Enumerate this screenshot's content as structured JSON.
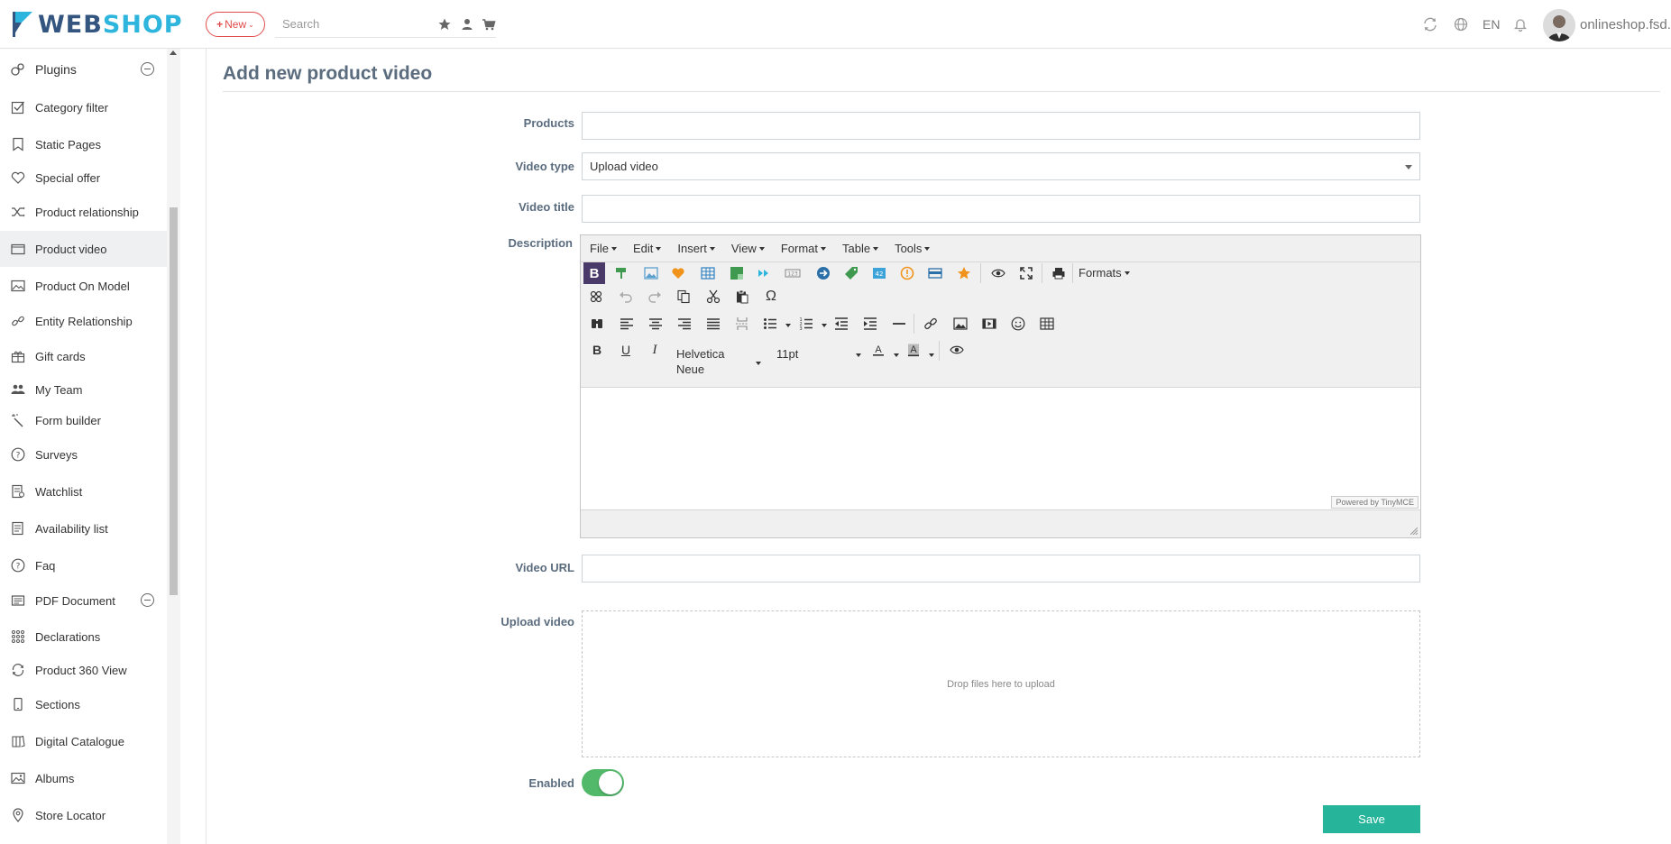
{
  "topbar": {
    "logo_web": "WEB",
    "logo_shop": "SHOP",
    "new_label": "New",
    "search_placeholder": "Search",
    "language": "EN",
    "shop_name": "onlineshop.fsd.rs"
  },
  "sidebar": {
    "section_label": "Plugins",
    "items": [
      {
        "label": "Category filter",
        "icon": "checkbox-icon"
      },
      {
        "label": "Static Pages",
        "icon": "bookmark-icon"
      },
      {
        "label": "Special offer",
        "icon": "heart-icon"
      },
      {
        "label": "Product relationship",
        "icon": "shuffle-icon"
      },
      {
        "label": "Product video",
        "icon": "video-icon"
      },
      {
        "label": "Product On Model",
        "icon": "image-icon"
      },
      {
        "label": "Entity Relationship",
        "icon": "link-icon"
      },
      {
        "label": "Gift cards",
        "icon": "gift-icon"
      },
      {
        "label": "My Team",
        "icon": "team-icon"
      },
      {
        "label": "Form builder",
        "icon": "wand-icon"
      },
      {
        "label": "Surveys",
        "icon": "question-icon"
      },
      {
        "label": "Watchlist",
        "icon": "watchlist-icon"
      },
      {
        "label": "Availability list",
        "icon": "list-icon"
      },
      {
        "label": "Faq",
        "icon": "question-icon"
      },
      {
        "label": "PDF Document",
        "icon": "document-icon"
      },
      {
        "label": "Declarations",
        "icon": "grid-icon"
      },
      {
        "label": "Product 360 View",
        "icon": "rotate-icon"
      },
      {
        "label": "Sections",
        "icon": "mobile-icon"
      },
      {
        "label": "Digital Catalogue",
        "icon": "catalogue-icon"
      },
      {
        "label": "Albums",
        "icon": "album-icon"
      },
      {
        "label": "Store Locator",
        "icon": "location-icon"
      }
    ],
    "active_item": "Product video"
  },
  "page": {
    "title": "Add new product video"
  },
  "form": {
    "products_label": "Products",
    "products_value": "",
    "video_type_label": "Video type",
    "video_type_value": "Upload video",
    "video_title_label": "Video title",
    "video_title_value": "",
    "description_label": "Description",
    "video_url_label": "Video URL",
    "video_url_value": "",
    "upload_video_label": "Upload video",
    "dropzone_text": "Drop files here to upload",
    "enabled_label": "Enabled",
    "enabled": true,
    "save_label": "Save"
  },
  "editor": {
    "menus": [
      "File",
      "Edit",
      "Insert",
      "View",
      "Format",
      "Table",
      "Tools"
    ],
    "formats_label": "Formats",
    "font_family_line1": "Helvetica",
    "font_family_line2": "Neue",
    "font_size": "11pt",
    "powered_by": "Powered by TinyMCE"
  },
  "colors": {
    "accent_green": "#26b59a",
    "toggle_green": "#52b96a",
    "new_red": "#e24b4b",
    "logo_dark": "#33557f",
    "logo_light": "#2eb5dd",
    "label_color": "#5a6c7e"
  }
}
